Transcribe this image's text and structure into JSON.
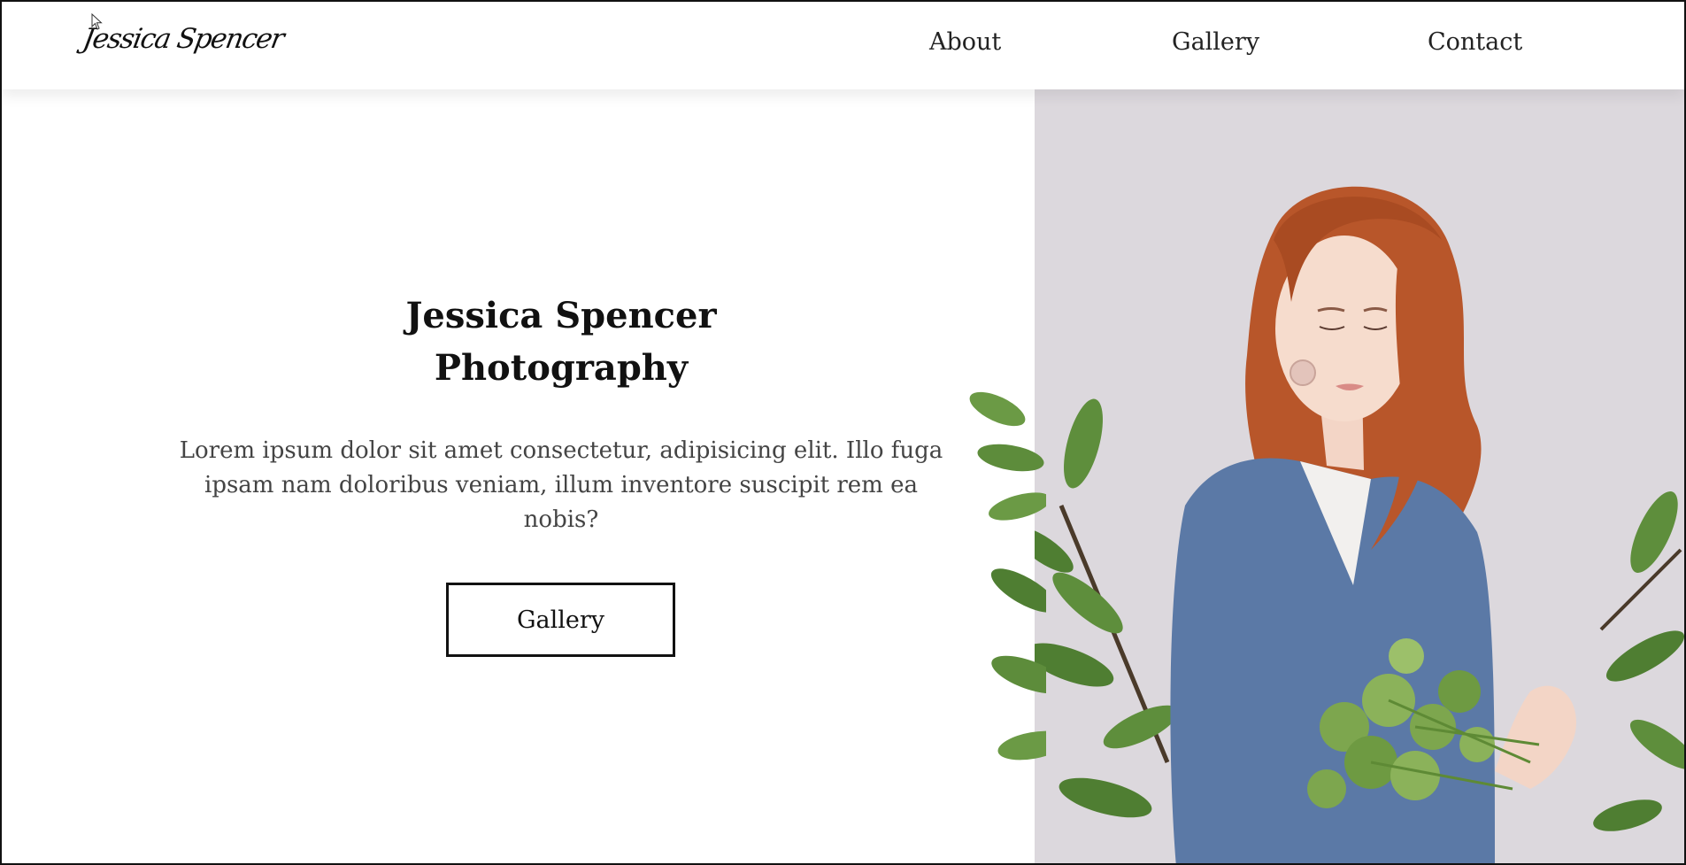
{
  "header": {
    "logo": "Jessica Spencer",
    "nav": [
      {
        "label": "About"
      },
      {
        "label": "Gallery"
      },
      {
        "label": "Contact"
      }
    ]
  },
  "hero": {
    "title_line1": "Jessica Spencer",
    "title_line2": "Photography",
    "description": "Lorem ipsum dolor sit amet consectetur, adipisicing elit. Illo fuga ipsam nam doloribus veniam, illum inventore suscipit rem ea nobis?",
    "button_label": "Gallery"
  },
  "colors": {
    "photo_background": "#dcd8dd",
    "sweater": "#5b79a6",
    "hair": "#b8562a",
    "leaves": "#5c8a3a"
  }
}
